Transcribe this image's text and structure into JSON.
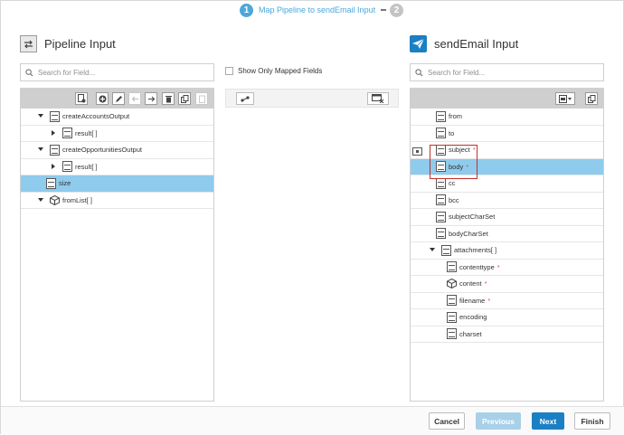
{
  "stepper": {
    "step1_number": "1",
    "step1_label": "Map Pipeline to sendEmail Input",
    "step2_number": "2"
  },
  "left_panel": {
    "title": "Pipeline Input",
    "search_placeholder": "Search for Field...",
    "rows": [
      {
        "label": "createAccountsOutput",
        "suffix": ""
      },
      {
        "label": "result",
        "suffix": " [ ]"
      },
      {
        "label": "createOpportunitiesOutput",
        "suffix": ""
      },
      {
        "label": "result",
        "suffix": " [ ]"
      },
      {
        "label": "size",
        "suffix": ""
      },
      {
        "label": "fromList",
        "suffix": " [ ]"
      }
    ]
  },
  "middle": {
    "show_mapped_label": "Show Only Mapped Fields"
  },
  "right_panel": {
    "title": "sendEmail Input",
    "search_placeholder": "Search for Field...",
    "rows": [
      {
        "label": "from",
        "required": ""
      },
      {
        "label": "to",
        "required": ""
      },
      {
        "label": "subject",
        "required": "*"
      },
      {
        "label": "body",
        "required": "*"
      },
      {
        "label": "cc",
        "required": ""
      },
      {
        "label": "bcc",
        "required": ""
      },
      {
        "label": "subjectCharSet",
        "required": ""
      },
      {
        "label": "bodyCharSet",
        "required": ""
      },
      {
        "label": "attachments",
        "suffix": " [ ]",
        "required": ""
      },
      {
        "label": "contenttype",
        "required": "*"
      },
      {
        "label": "content",
        "required": "*"
      },
      {
        "label": "filename",
        "required": "*"
      },
      {
        "label": "encoding",
        "required": ""
      },
      {
        "label": "charset",
        "required": ""
      }
    ]
  },
  "footer": {
    "cancel": "Cancel",
    "previous": "Previous",
    "next": "Next",
    "finish": "Finish"
  },
  "colors": {
    "accent": "#1b7fc4",
    "selected_row": "#8ecbec",
    "step_active": "#4aa8db",
    "highlight_box": "#c0302b"
  }
}
